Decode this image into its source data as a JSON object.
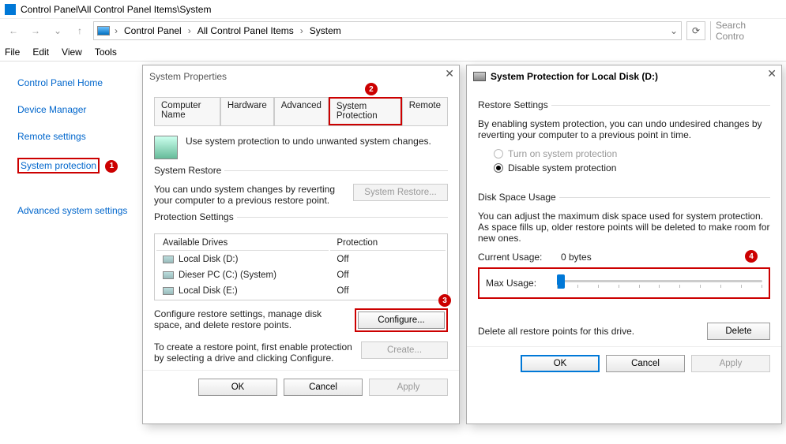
{
  "titlebar": {
    "path": "Control Panel\\All Control Panel Items\\System"
  },
  "address": {
    "parts": [
      "Control Panel",
      "All Control Panel Items",
      "System"
    ],
    "dropdown_chev": "⌄",
    "refresh": "⟳"
  },
  "search": {
    "placeholder": "Search Contro"
  },
  "menubar": [
    "File",
    "Edit",
    "View",
    "Tools"
  ],
  "sidebar": {
    "home": "Control Panel Home",
    "items": [
      "Device Manager",
      "Remote settings",
      "System protection",
      "Advanced system settings"
    ]
  },
  "sp": {
    "title": "System Properties",
    "tabs": [
      "Computer Name",
      "Hardware",
      "Advanced",
      "System Protection",
      "Remote"
    ],
    "intro": "Use system protection to undo unwanted system changes.",
    "restore_legend": "System Restore",
    "restore_txt": "You can undo system changes by reverting your computer to a previous restore point.",
    "restore_btn": "System Restore...",
    "prot_legend": "Protection Settings",
    "drives_hdrs": [
      "Available Drives",
      "Protection"
    ],
    "drives": [
      {
        "name": "Local Disk (D:)",
        "prot": "Off"
      },
      {
        "name": "Dieser PC (C:) (System)",
        "prot": "Off"
      },
      {
        "name": "Local Disk (E:)",
        "prot": "Off"
      }
    ],
    "config_txt": "Configure restore settings, manage disk space, and delete restore points.",
    "config_btn": "Configure...",
    "create_txt": "To create a restore point, first enable protection by selecting a drive and clicking Configure.",
    "create_btn": "Create...",
    "ok": "OK",
    "cancel": "Cancel",
    "apply": "Apply"
  },
  "pd": {
    "title": "System Protection for Local Disk (D:)",
    "rs_legend": "Restore Settings",
    "rs_txt": "By enabling system protection, you can undo undesired changes by reverting your computer to a previous point in time.",
    "opt_on": "Turn on system protection",
    "opt_off": "Disable system protection",
    "du_legend": "Disk Space Usage",
    "du_txt": "You can adjust the maximum disk space used for system protection. As space fills up, older restore points will be deleted to make room for new ones.",
    "cur_lbl": "Current Usage:",
    "cur_val": "0 bytes",
    "max_lbl": "Max Usage:",
    "del_txt": "Delete all restore points for this drive.",
    "del_btn": "Delete",
    "ok": "OK",
    "cancel": "Cancel",
    "apply": "Apply"
  },
  "badges": {
    "b1": "1",
    "b2": "2",
    "b3": "3",
    "b4": "4"
  }
}
